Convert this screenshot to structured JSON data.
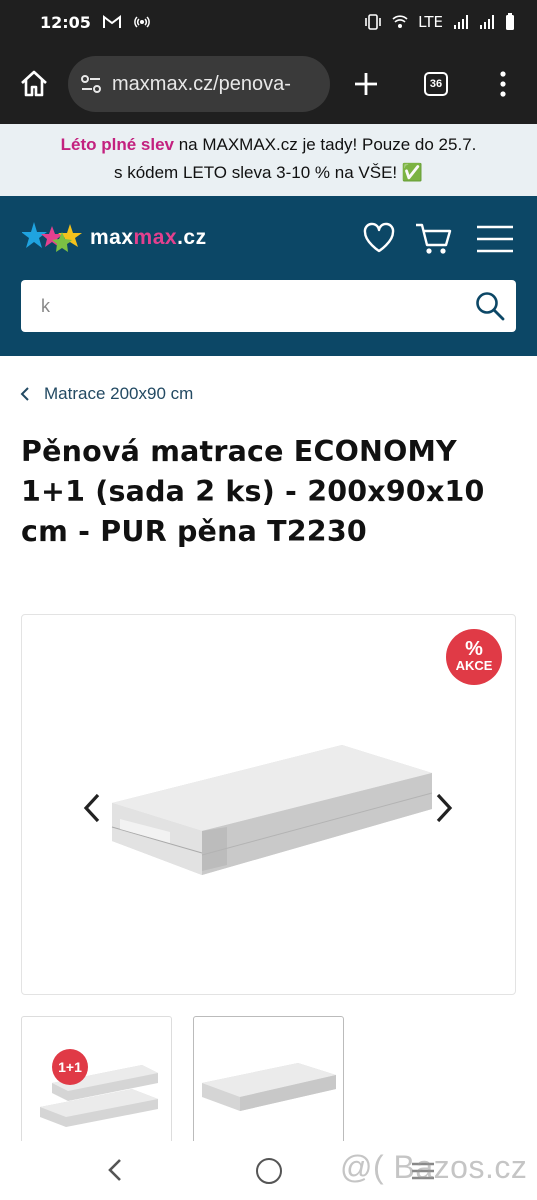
{
  "status_bar": {
    "time": "12:05",
    "network": "LTE",
    "icons": [
      "gmail-icon",
      "hotspot-icon",
      "vibrate-icon",
      "wifi-calling-icon",
      "signal-icon",
      "signal-icon",
      "battery-icon"
    ]
  },
  "browser": {
    "url": "maxmax.cz/penova-",
    "tab_count": "36",
    "icons": [
      "home-icon",
      "tune-icon",
      "plus-icon",
      "tabs-icon",
      "more-vert-icon"
    ]
  },
  "promo": {
    "highlight": "Léto plné slev",
    "text_1": " na MAXMAX.cz je tady! Pouze do 25.7.",
    "text_2": "s kódem LETO sleva 3-10 % na VŠE! ✅"
  },
  "header": {
    "logo_white": "max",
    "logo_pink": "max",
    "logo_suffix": ".cz",
    "colors": {
      "header_bg": "#0c4766",
      "accent_pink": "#e4408e",
      "accent_red": "#e03a46"
    }
  },
  "search": {
    "value": "k",
    "placeholder": ""
  },
  "breadcrumb": {
    "label": "Matrace 200x90 cm"
  },
  "product": {
    "title": "Pěnová matrace ECONOMY 1+1 (sada 2 ks) - 200x90x10 cm - PUR pěna T2230",
    "badge_symbol": "%",
    "badge_label": "AKCE",
    "thumb_badge": "1+1"
  },
  "watermark": "@( Bazos.cz"
}
